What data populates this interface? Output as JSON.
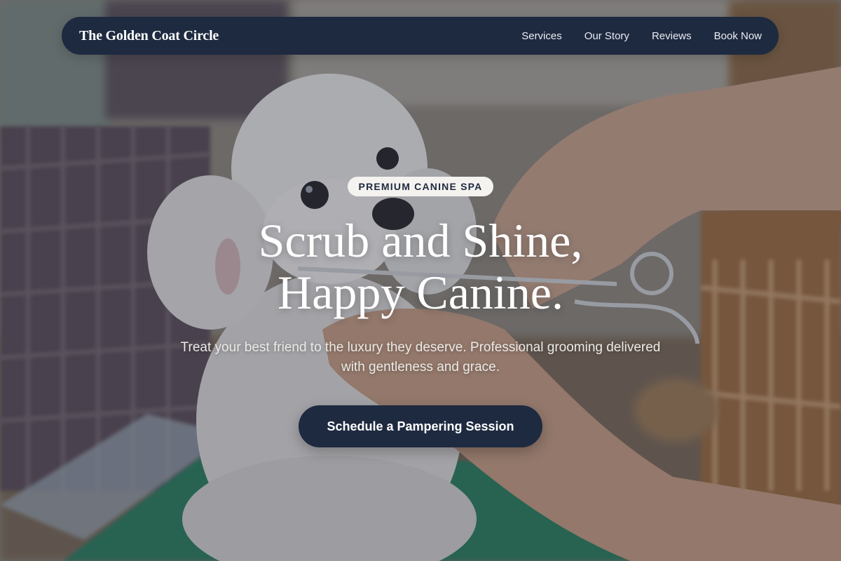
{
  "brand": {
    "name": "The Golden Coat Circle"
  },
  "nav": {
    "links": [
      {
        "label": "Services"
      },
      {
        "label": "Our Story"
      },
      {
        "label": "Reviews"
      },
      {
        "label": "Book Now"
      }
    ]
  },
  "hero": {
    "badge": "PREMIUM CANINE SPA",
    "title_line1": "Scrub and Shine,",
    "title_line2": "Happy Canine.",
    "subtitle": "Treat your best friend to the luxury they deserve. Professional grooming delivered with gentleness and grace.",
    "cta_label": "Schedule a Pampering Session",
    "background_image": "white poodle being groomed with scissors"
  },
  "colors": {
    "navy": "#1e2a40",
    "badge_bg": "#f5f3ef",
    "text_light": "#ffffff"
  }
}
